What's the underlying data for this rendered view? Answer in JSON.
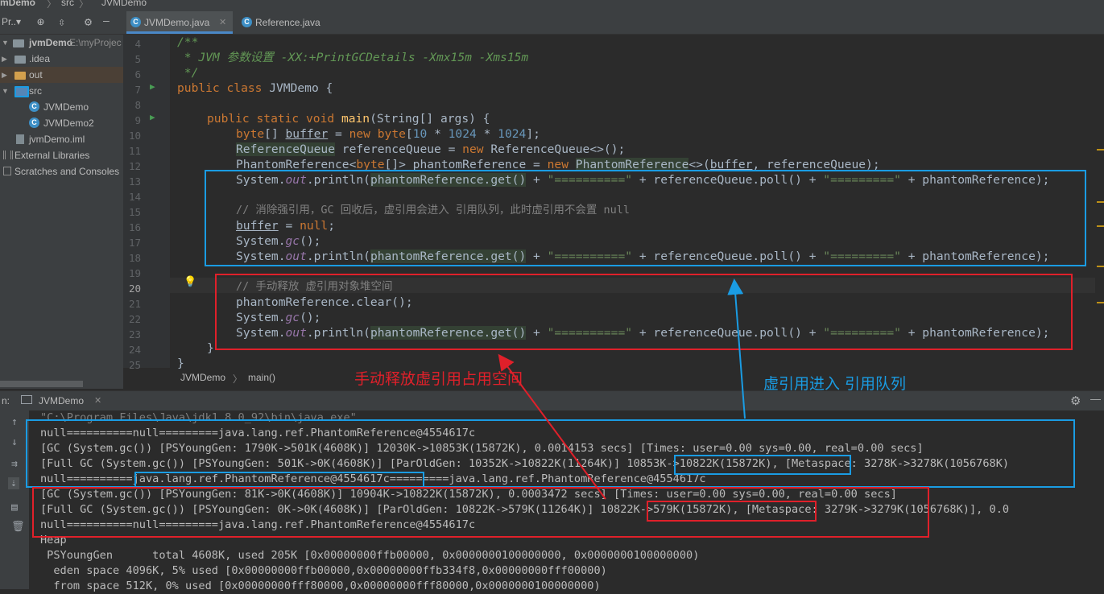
{
  "breadcrumb_top": {
    "project": "mDemo",
    "folder": "src",
    "file": "JVMDemo"
  },
  "toolbar": {
    "project_label": "Pr..▾"
  },
  "tabs": [
    {
      "label": "JVMDemo.java",
      "active": true
    },
    {
      "label": "Reference.java",
      "active": false
    }
  ],
  "project_tree": {
    "root": {
      "name": "jvmDemo",
      "path": "E:\\myProjec"
    },
    "items": [
      {
        "label": ".idea",
        "icon": "folder-icon"
      },
      {
        "label": "out",
        "icon": "folder-orange-icon"
      },
      {
        "label": "src",
        "icon": "folder-blue-icon"
      },
      {
        "label": "JVMDemo",
        "icon": "java-class-icon"
      },
      {
        "label": "JVMDemo2",
        "icon": "java-class-icon"
      },
      {
        "label": "jvmDemo.iml",
        "icon": "module-file-icon"
      },
      {
        "label": "External Libraries",
        "icon": "library-icon"
      },
      {
        "label": "Scratches and Consoles",
        "icon": "scratches-icon"
      }
    ]
  },
  "line_numbers": [
    "4",
    "5",
    "6",
    "7",
    "8",
    "9",
    "10",
    "11",
    "12",
    "13",
    "14",
    "15",
    "16",
    "17",
    "18",
    "19",
    "20",
    "21",
    "22",
    "23",
    "24",
    "25"
  ],
  "code": {
    "l4": "/**",
    "l5": " * JVM 参数设置 -XX:+PrintGCDetails -Xmx15m -Xms15m",
    "l6": " */",
    "l7_kw": "public class ",
    "l7_name": "JVMDemo {",
    "l9_kw": "public static void ",
    "l9_m": "main",
    "l9_rest": "(String[] args) {",
    "l10_t": "byte",
    "l10_a": "[] ",
    "l10_v": "buffer",
    "l10_b": " = ",
    "l10_new": "new ",
    "l10_t2": "byte",
    "l10_c": "[",
    "l10_n1": "10",
    "l10_d": " * ",
    "l10_n2": "1024",
    "l10_e": " * ",
    "l10_n3": "1024",
    "l10_f": "];",
    "l11_cls": "ReferenceQueue",
    "l11_a": " referenceQueue = ",
    "l11_new": "new ",
    "l11_b": "ReferenceQueue<>();",
    "l12_a": "PhantomReference<",
    "l12_t": "byte",
    "l12_b": "[]> phantomReference = ",
    "l12_new": "new ",
    "l12_cls": "PhantomReference",
    "l12_c": "<>(",
    "l12_v": "buffer",
    "l12_d": ", referenceQueue);",
    "sys": "System.",
    "out": "out",
    "println": ".println(",
    "get": "phantomReference.get()",
    "plus": " + ",
    "eq1": "\"==========\"",
    "poll": " + referenceQueue.poll() + ",
    "eq2": "\"=========\"",
    "tail": " + phantomReference);",
    "l15": "// 消除强引用，GC 回收后，虚引用会进入 引用队列，此时虚引用不会置 null",
    "l16_v": "buffer",
    "l16_a": " = ",
    "l16_null": "null",
    "l16_b": ";",
    "gc": "gc",
    "gc_tail": "();",
    "l20": "// 手动释放 虚引用对象堆空间",
    "l21": "phantomReference.clear();",
    "l24": "}",
    "l25": "}"
  },
  "editor_breadcrumb": {
    "cls": "JVMDemo",
    "method": "main()"
  },
  "annotations": {
    "red_text": "手动释放虚引用占用空间",
    "blue_text": "虚引用进入 引用队列"
  },
  "run_panel": {
    "label": "n:",
    "tab": "JVMDemo",
    "console": [
      "\"C:\\Program Files\\Java\\jdk1.8.0_92\\bin\\java.exe\" ...",
      "null==========null=========java.lang.ref.PhantomReference@4554617c",
      "[GC (System.gc()) [PSYoungGen: 1790K->501K(4608K)] 12030K->10853K(15872K), 0.0014153 secs] [Times: user=0.00 sys=0.00, real=0.00 secs]",
      "[Full GC (System.gc()) [PSYoungGen: 501K->0K(4608K)] [ParOldGen: 10352K->10822K(11264K)] 10853K->10822K(15872K), [Metaspace: 3278K->3278K(1056768K)",
      "null==========java.lang.ref.PhantomReference@4554617c=========java.lang.ref.PhantomReference@4554617c",
      "[GC (System.gc()) [PSYoungGen: 81K->0K(4608K)] 10904K->10822K(15872K), 0.0003472 secs] [Times: user=0.00 sys=0.00, real=0.00 secs]",
      "[Full GC (System.gc()) [PSYoungGen: 0K->0K(4608K)] [ParOldGen: 10822K->579K(11264K)] 10822K->579K(15872K), [Metaspace: 3279K->3279K(1056768K)], 0.0",
      "null==========null=========java.lang.ref.PhantomReference@4554617c",
      "Heap",
      " PSYoungGen      total 4608K, used 205K [0x00000000ffb00000, 0x0000000100000000, 0x0000000100000000)",
      "  eden space 4096K, 5% used [0x00000000ffb00000,0x00000000ffb334f8,0x00000000fff00000)",
      "  from space 512K, 0% used [0x00000000fff80000,0x00000000fff80000,0x0000000100000000)"
    ]
  },
  "colors": {
    "annotation_blue": "#1a9ce3",
    "annotation_red": "#e0202a",
    "accent": "#4a88c7"
  }
}
